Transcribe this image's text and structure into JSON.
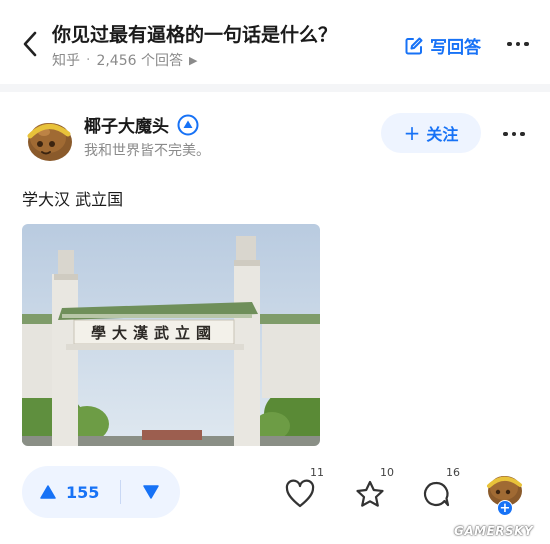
{
  "question": {
    "title": "你见过最有逼格的一句话是什么？",
    "source": "知乎",
    "answer_count": "2,456 个回答",
    "write_answer_label": "写回答"
  },
  "author": {
    "name": "椰子大魔头",
    "bio": "我和世界皆不完美。",
    "follow_label": "关注"
  },
  "answer": {
    "text": "学大汉 武立国",
    "image_inscription": "學大漢武立國"
  },
  "actions": {
    "upvote_count": "155",
    "like_count": "11",
    "favorite_count": "10",
    "comment_count": "16"
  },
  "watermark": "GAMERSKY",
  "colors": {
    "accent": "#1772f6",
    "accent_bg": "#eef4ff",
    "muted": "#8a8a8a"
  },
  "icons": [
    "back-icon",
    "edit-icon",
    "more-icon",
    "verified-icon",
    "plus-icon",
    "upvote-icon",
    "downvote-icon",
    "heart-icon",
    "star-icon",
    "comment-icon"
  ]
}
